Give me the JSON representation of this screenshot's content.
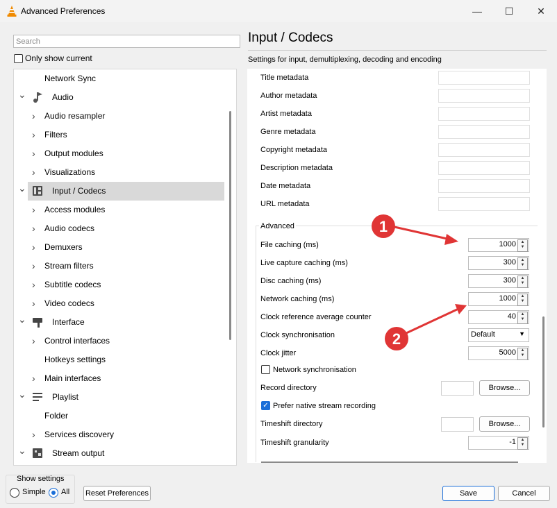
{
  "window": {
    "title": "Advanced Preferences",
    "minimize": "—",
    "maximize": "☐",
    "close": "✕"
  },
  "search": {
    "placeholder": "Search"
  },
  "only_show_current": "Only show current",
  "tree": [
    {
      "label": "Network Sync",
      "level": 1,
      "chevron": "",
      "icon": ""
    },
    {
      "label": "Audio",
      "level": 0,
      "chevron": "expanded",
      "icon": "audio-icon"
    },
    {
      "label": "Audio resampler",
      "level": 1,
      "chevron": "collapsed",
      "icon": ""
    },
    {
      "label": "Filters",
      "level": 1,
      "chevron": "collapsed",
      "icon": ""
    },
    {
      "label": "Output modules",
      "level": 1,
      "chevron": "collapsed",
      "icon": ""
    },
    {
      "label": "Visualizations",
      "level": 1,
      "chevron": "collapsed",
      "icon": ""
    },
    {
      "label": "Input / Codecs",
      "level": 0,
      "chevron": "expanded",
      "icon": "input-codecs-icon",
      "selected": true
    },
    {
      "label": "Access modules",
      "level": 1,
      "chevron": "collapsed",
      "icon": ""
    },
    {
      "label": "Audio codecs",
      "level": 1,
      "chevron": "collapsed",
      "icon": ""
    },
    {
      "label": "Demuxers",
      "level": 1,
      "chevron": "collapsed",
      "icon": ""
    },
    {
      "label": "Stream filters",
      "level": 1,
      "chevron": "collapsed",
      "icon": ""
    },
    {
      "label": "Subtitle codecs",
      "level": 1,
      "chevron": "collapsed",
      "icon": ""
    },
    {
      "label": "Video codecs",
      "level": 1,
      "chevron": "collapsed",
      "icon": ""
    },
    {
      "label": "Interface",
      "level": 0,
      "chevron": "expanded",
      "icon": "interface-icon"
    },
    {
      "label": "Control interfaces",
      "level": 1,
      "chevron": "collapsed",
      "icon": ""
    },
    {
      "label": "Hotkeys settings",
      "level": 1,
      "chevron": "",
      "icon": ""
    },
    {
      "label": "Main interfaces",
      "level": 1,
      "chevron": "collapsed",
      "icon": ""
    },
    {
      "label": "Playlist",
      "level": 0,
      "chevron": "expanded",
      "icon": "playlist-icon"
    },
    {
      "label": "Folder",
      "level": 1,
      "chevron": "",
      "icon": ""
    },
    {
      "label": "Services discovery",
      "level": 1,
      "chevron": "collapsed",
      "icon": ""
    },
    {
      "label": "Stream output",
      "level": 0,
      "chevron": "expanded",
      "icon": "stream-output-icon"
    }
  ],
  "panel": {
    "heading": "Input / Codecs",
    "subtitle": "Settings for input, demultiplexing, decoding and encoding",
    "metadata": [
      "Title metadata",
      "Author metadata",
      "Artist metadata",
      "Genre metadata",
      "Copyright metadata",
      "Description metadata",
      "Date metadata",
      "URL metadata"
    ],
    "advanced_label": "Advanced",
    "file_caching": {
      "label": "File caching (ms)",
      "value": "1000"
    },
    "live_capture_caching": {
      "label": "Live capture caching (ms)",
      "value": "300"
    },
    "disc_caching": {
      "label": "Disc caching (ms)",
      "value": "300"
    },
    "network_caching": {
      "label": "Network caching (ms)",
      "value": "1000"
    },
    "clock_reference": {
      "label": "Clock reference average counter",
      "value": "40"
    },
    "clock_sync": {
      "label": "Clock synchronisation",
      "value": "Default"
    },
    "clock_jitter": {
      "label": "Clock jitter",
      "value": "5000"
    },
    "network_sync": {
      "label": "Network synchronisation",
      "checked": false
    },
    "record_directory": {
      "label": "Record directory",
      "button": "Browse..."
    },
    "prefer_native": {
      "label": "Prefer native stream recording",
      "checked": true
    },
    "timeshift_directory": {
      "label": "Timeshift directory",
      "button": "Browse..."
    },
    "timeshift_granularity": {
      "label": "Timeshift granularity",
      "value": "-1"
    }
  },
  "annotations": {
    "marker1": "1",
    "marker2": "2",
    "color": "#e03535"
  },
  "bottom": {
    "show_settings": "Show settings",
    "simple": "Simple",
    "all": "All",
    "selected": "All",
    "reset": "Reset Preferences",
    "save": "Save",
    "cancel": "Cancel"
  }
}
